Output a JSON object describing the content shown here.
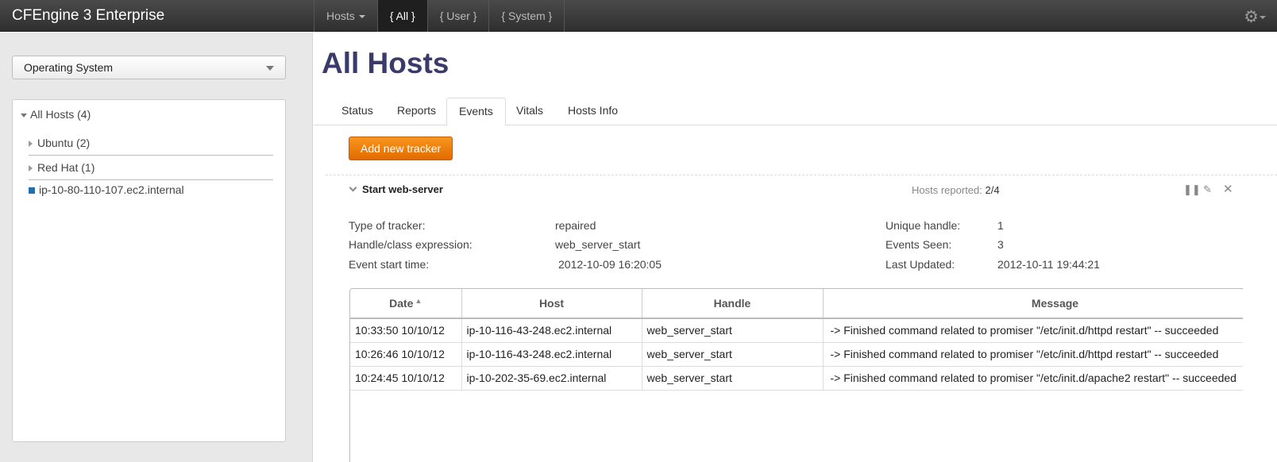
{
  "app": {
    "title": "CFEngine 3 Enterprise"
  },
  "nav": {
    "tabs": [
      {
        "label": "Hosts"
      },
      {
        "label": "{ All }"
      },
      {
        "label": "{ User }"
      },
      {
        "label": "{ System }"
      }
    ],
    "settings_icon": "gear-icon"
  },
  "sidebar": {
    "select": {
      "value": "Operating System"
    },
    "tree": {
      "root": "All Hosts (4)",
      "items": [
        {
          "label": "Ubuntu (2)"
        },
        {
          "label": "Red Hat (1)"
        },
        {
          "label": "ip-10-80-110-107.ec2.internal"
        }
      ]
    }
  },
  "main": {
    "title": "All Hosts",
    "tabs": [
      {
        "label": "Status"
      },
      {
        "label": "Reports"
      },
      {
        "label": "Events"
      },
      {
        "label": "Vitals"
      },
      {
        "label": "Hosts Info"
      }
    ],
    "add_tracker_label": "Add new tracker",
    "tracker": {
      "name": "Start web-server",
      "hosts_reported_label": "Hosts reported:",
      "hosts_reported_value": "2/4",
      "left": [
        {
          "label": "Type of tracker:",
          "value": "repaired"
        },
        {
          "label": "Handle/class expression:",
          "value": "web_server_start"
        },
        {
          "label": "Event start time:",
          "value": "2012-10-09 16:20:05"
        }
      ],
      "right": [
        {
          "label": "Unique handle:",
          "value": "1"
        },
        {
          "label": "Events Seen:",
          "value": "3"
        },
        {
          "label": "Last Updated:",
          "value": "2012-10-11 19:44:21"
        }
      ]
    },
    "table": {
      "headers": [
        "Date",
        "Host",
        "Handle",
        "Message"
      ],
      "rows": [
        {
          "date": "10:33:50 10/10/12",
          "host": "ip-10-116-43-248.ec2.internal",
          "handle": "web_server_start",
          "message": "-> Finished command related to promiser \"/etc/init.d/httpd restart\" -- succeeded"
        },
        {
          "date": "10:26:46 10/10/12",
          "host": "ip-10-116-43-248.ec2.internal",
          "handle": "web_server_start",
          "message": "-> Finished command related to promiser \"/etc/init.d/httpd restart\" -- succeeded"
        },
        {
          "date": "10:24:45 10/10/12",
          "host": "ip-10-202-35-69.ec2.internal",
          "handle": "web_server_start",
          "message": "-> Finished command related to promiser \"/etc/init.d/apache2 restart\" -- succeeded"
        }
      ]
    }
  },
  "colors": {
    "accent": "#f08300",
    "title": "#3b3b6b",
    "topbar": "#333333",
    "host_marker": "#1f6fb2"
  }
}
